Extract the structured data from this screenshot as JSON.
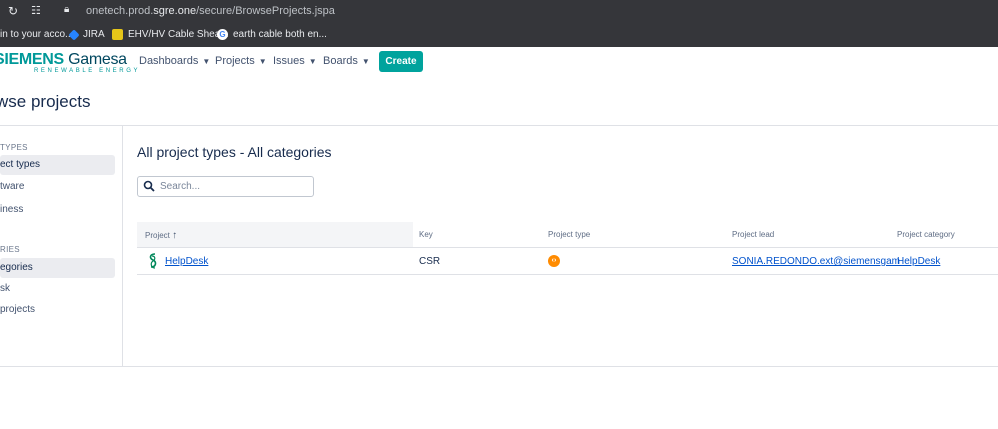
{
  "browser": {
    "url_prefix": "onetech.prod.",
    "url_domain": "sgre.one",
    "url_path": "/secure/BrowseProjects.jspa",
    "bookmarks": [
      {
        "label": "in to your acco..."
      },
      {
        "label": "JIRA"
      },
      {
        "label": "EHV/HV Cable Shea..."
      },
      {
        "label": "earth cable both en..."
      }
    ]
  },
  "header": {
    "logo_main": "SIEMENS",
    "logo_secondary": "Gamesa",
    "logo_sub": "RENEWABLE ENERGY",
    "menu": [
      {
        "label": "Dashboards"
      },
      {
        "label": "Projects"
      },
      {
        "label": "Issues"
      },
      {
        "label": "Boards"
      }
    ],
    "create_label": "Create"
  },
  "page": {
    "title": "wse projects"
  },
  "sidebar": {
    "types_heading": "TYPES",
    "types": [
      {
        "label": "ect types",
        "active": true
      },
      {
        "label": "tware",
        "active": false
      },
      {
        "label": "iness",
        "active": false
      }
    ],
    "categories_heading": "RIES",
    "categories": [
      {
        "label": "egories",
        "active": true
      },
      {
        "label": "sk",
        "active": false
      },
      {
        "label": "projects",
        "active": false
      }
    ]
  },
  "main": {
    "title": "All project types - All categories",
    "search_placeholder": "Search..."
  },
  "table": {
    "columns": [
      "Project",
      "Key",
      "Project type",
      "Project lead",
      "Project category"
    ],
    "sort_indicator": "↑",
    "rows": [
      {
        "project": "HelpDesk",
        "key": "CSR",
        "type_icon": "software-project-icon",
        "lead": "SONIA.REDONDO.ext@siemensgam",
        "category": "HelpDesk"
      }
    ]
  },
  "colors": {
    "accent": "#00a39d",
    "link": "#0052cc",
    "type_icon": "#ff8b00"
  }
}
